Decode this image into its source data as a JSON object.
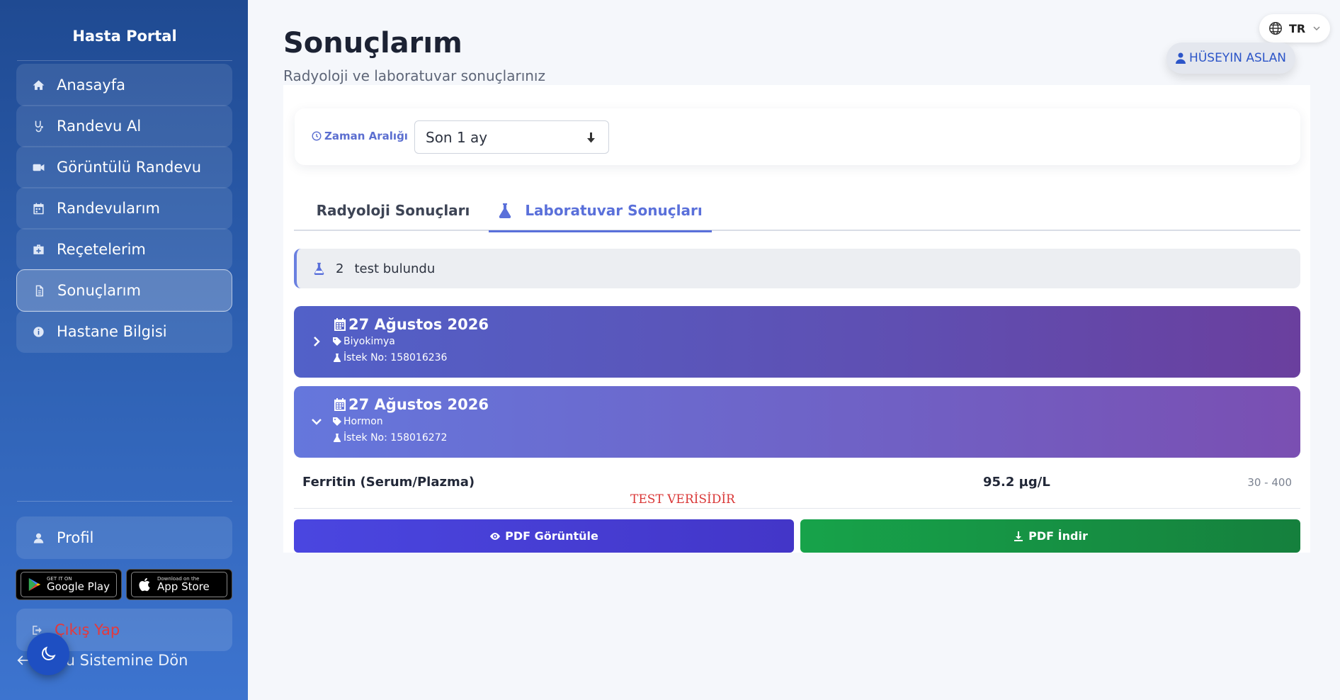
{
  "sidebar": {
    "brand": "Hasta Portal",
    "items": [
      {
        "label": "Anasayfa",
        "icon": "home-icon"
      },
      {
        "label": "Randevu Al",
        "icon": "stethoscope-icon"
      },
      {
        "label": "Görüntülü Randevu",
        "icon": "video-icon"
      },
      {
        "label": "Randevularım",
        "icon": "calendar-icon"
      },
      {
        "label": "Reçetelerim",
        "icon": "medkit-icon"
      },
      {
        "label": "Sonuçlarım",
        "icon": "document-icon",
        "active": true
      },
      {
        "label": "Hastane Bilgisi",
        "icon": "info-icon"
      }
    ],
    "profile_label": "Profil",
    "google_play": {
      "small": "GET IT ON",
      "big": "Google Play"
    },
    "app_store": {
      "small": "Download on the",
      "big": "App Store"
    },
    "logout_label": "Çıkış Yap",
    "back_label": "devu Sistemine Dön"
  },
  "header": {
    "title": "Sonuçlarım",
    "subtitle": "Radyoloji ve laboratuvar sonuçlarınız",
    "language": "TR",
    "user_name": "HÜSEYIN ASLAN"
  },
  "filter": {
    "label": "Zaman Aralığı",
    "selected": "Son 1 ay"
  },
  "tabs": [
    {
      "label": "Radyoloji Sonuçları",
      "active": false
    },
    {
      "label": "Laboratuvar Sonuçları",
      "active": true
    }
  ],
  "summary": {
    "count": "2",
    "text": "test bulundu"
  },
  "groups": [
    {
      "date": "27 Ağustos 2026",
      "category": "Biyokimya",
      "request": "İstek No: 158016236",
      "expanded": false
    },
    {
      "date": "27 Ağustos 2026",
      "category": "Hormon",
      "request": "İstek No: 158016272",
      "expanded": true
    }
  ],
  "results": [
    {
      "name": "Ferritin (Serum/Plazma)",
      "value": "95.2 µg/L",
      "range": "30 - 400"
    }
  ],
  "test_note": "TEST VERİSİDİR",
  "buttons": {
    "view_pdf": "PDF Görüntüle",
    "download_pdf": "PDF İndir"
  },
  "colors": {
    "accent": "#5a70da",
    "sidebar_top": "#1f4a92",
    "sidebar_bottom": "#3d74cf",
    "danger": "#e5393b",
    "success": "#17a34a"
  }
}
